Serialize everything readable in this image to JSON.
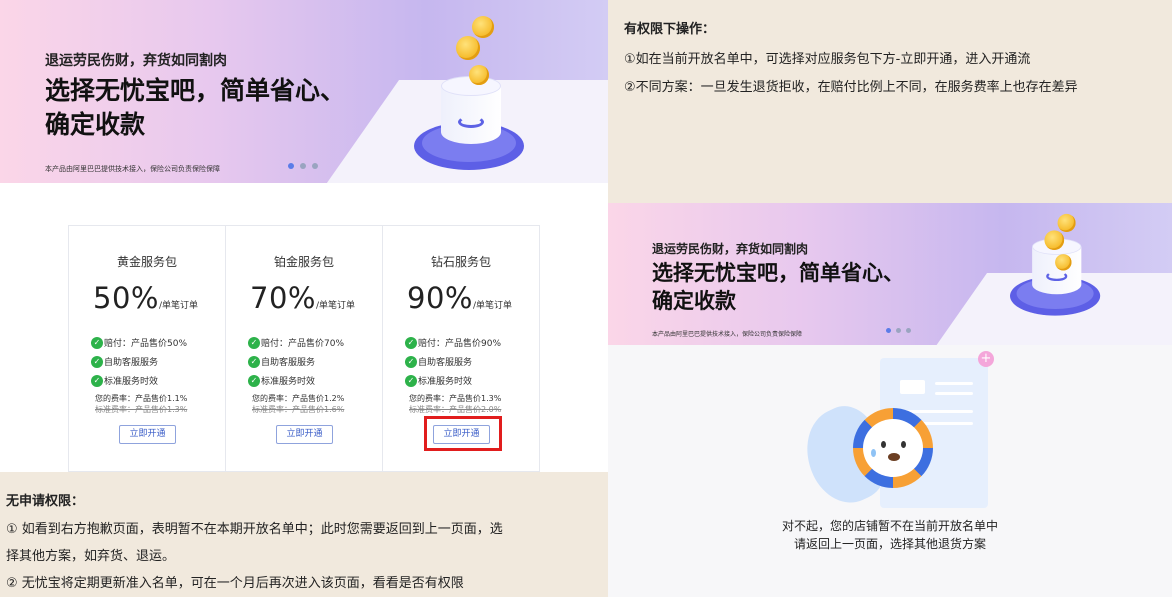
{
  "left": {
    "banner": {
      "subtitle": "退运劳民伤财，弃货如同割肉",
      "headline_line1": "选择无忧宝吧，简单省心、",
      "headline_line2": "确定收款",
      "footnote": "本产品由阿里巴巴提供技术接入，保险公司负责保险保障",
      "carousel_count": 3,
      "carousel_active": 1
    },
    "packages": [
      {
        "name": "黄金服务包",
        "percent": "50%",
        "unit": "/单笔订单",
        "features": [
          "赔付：产品售价50%",
          "自助客服服务",
          "标准服务时效"
        ],
        "your_rate": "您的费率：产品售价1.1%",
        "standard_rate": "标准费率：产品售价1.3%",
        "button": "立即开通"
      },
      {
        "name": "铂金服务包",
        "percent": "70%",
        "unit": "/单笔订单",
        "features": [
          "赔付：产品售价70%",
          "自助客服服务",
          "标准服务时效"
        ],
        "your_rate": "您的费率：产品售价1.2%",
        "standard_rate": "标准费率：产品售价1.6%",
        "button": "立即开通"
      },
      {
        "name": "钻石服务包",
        "percent": "90%",
        "unit": "/单笔订单",
        "features": [
          "赔付：产品售价90%",
          "自助客服服务",
          "标准服务时效"
        ],
        "your_rate": "您的费率：产品售价1.3%",
        "standard_rate": "标准费率：产品售价2.0%",
        "button": "立即开通"
      }
    ],
    "notes": {
      "heading": "无申请权限：",
      "line1": "① 如看到右方抱歉页面，表明暂不在本期开放名单中；此时您需要返回到上一页面，选",
      "line2": "择其他方案，如弃货、退运。",
      "line3": "② 无忧宝将定期更新准入名单，可在一个月后再次进入该页面，看看是否有权限"
    }
  },
  "right": {
    "notes": {
      "heading": "有权限下操作：",
      "line1": "①如在当前开放名单中，可选择对应服务包下方-立即开通，进入开通流",
      "line2": "②不同方案：一旦发生退货拒收，在赔付比例上不同，在服务费率上也存在差异"
    },
    "banner": {
      "subtitle": "退运劳民伤财，弃货如同割肉",
      "headline_line1": "选择无忧宝吧，简单省心、",
      "headline_line2": "确定收款",
      "footnote": "本产品由阿里巴巴提供技术接入，保险公司负责保险保障"
    },
    "error": {
      "line1": "对不起，您的店铺暂不在当前开放名单中",
      "line2": "请返回上一页面，选择其他退货方案"
    }
  },
  "icons": {
    "feature_check": "check-circle-icon",
    "plus": "plus-icon"
  },
  "colors": {
    "check_green": "#2db24a",
    "button_blue": "#3a5cc7",
    "highlight_red": "#e11d1d",
    "note_bg": "#f1e9dd"
  }
}
